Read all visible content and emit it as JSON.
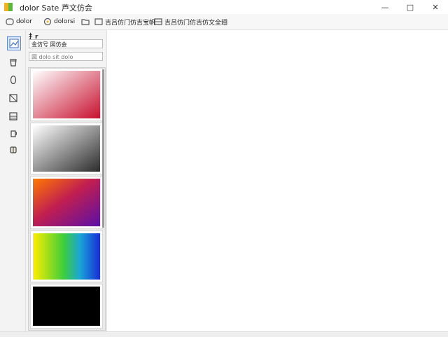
{
  "app": {
    "title": "dolor Sate 芦文仿会",
    "icon_colors": [
      "#f2b21c",
      "#5bb83a"
    ]
  },
  "window_controls": {
    "minimize": "—",
    "maximize": "□",
    "close": "✕"
  },
  "toolbar": {
    "item1_label": "dolor",
    "item2_label": "dolorsi",
    "item3_label": "",
    "item4_label": "吉吕仿门仿吉宝帆",
    "item5_label": "吉吕仿门仿吉仿文全翅"
  },
  "tools": [
    "image-icon",
    "bucket-icon",
    "oval-icon",
    "crop-icon",
    "layers-icon",
    "cup-icon",
    "eraser-icon"
  ],
  "panel": {
    "header": "扌r",
    "field1_value": "金仿号 図仿会",
    "field2_placeholder": "図 dolo sit dolo"
  },
  "swatches": [
    {
      "name": "red-gradient",
      "from": "#ffffff",
      "to": "#c8102e"
    },
    {
      "name": "gray-gradient",
      "from": "#ffffff",
      "to": "#2b2b2b"
    },
    {
      "name": "orange-purple-gradient",
      "from": "#ff7a00",
      "to": "#5a0fa8"
    },
    {
      "name": "rainbow-gradient",
      "from": "#ffee00",
      "to": "#1a2bd8"
    },
    {
      "name": "black-swatch",
      "from": "#000000",
      "to": "#000000"
    }
  ],
  "colors": {
    "accent": "#5a8bd6",
    "panel_bg": "#f3f3f3"
  }
}
